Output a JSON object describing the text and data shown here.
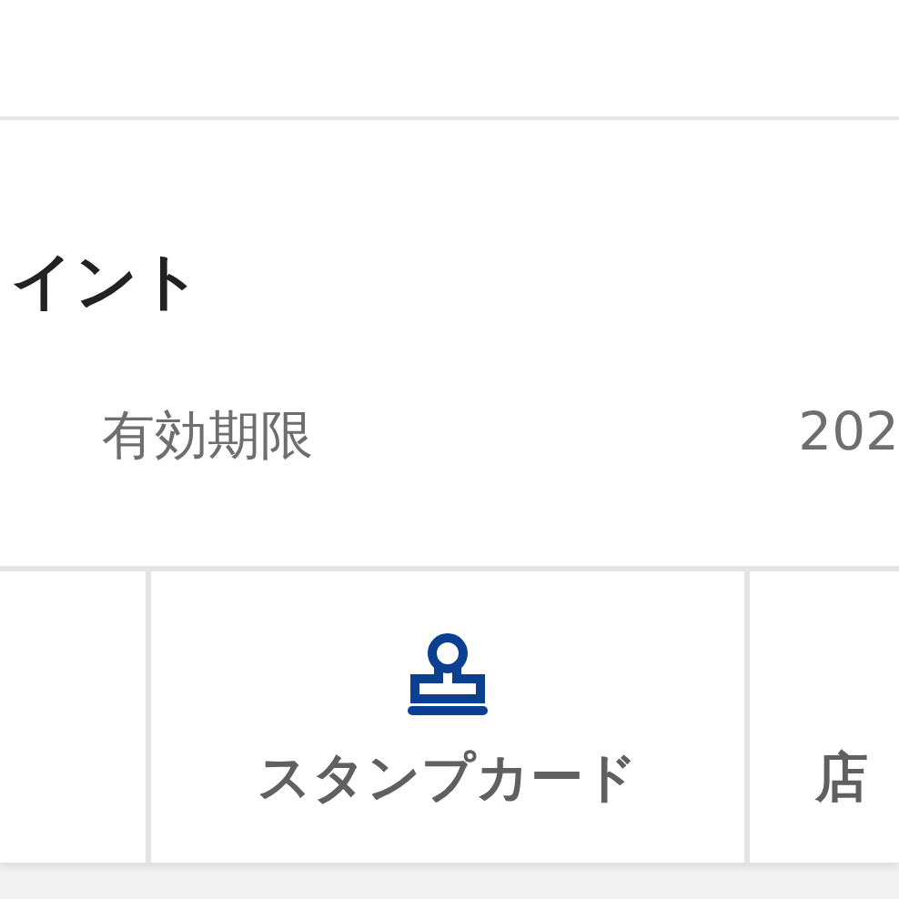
{
  "points_card": {
    "title": "イント",
    "expiry_label": "有効期限",
    "expiry_date": "202"
  },
  "tiles": [
    {
      "kind": "blank"
    },
    {
      "kind": "stamp",
      "label": "スタンプカード"
    },
    {
      "kind": "text",
      "label": "店"
    }
  ]
}
